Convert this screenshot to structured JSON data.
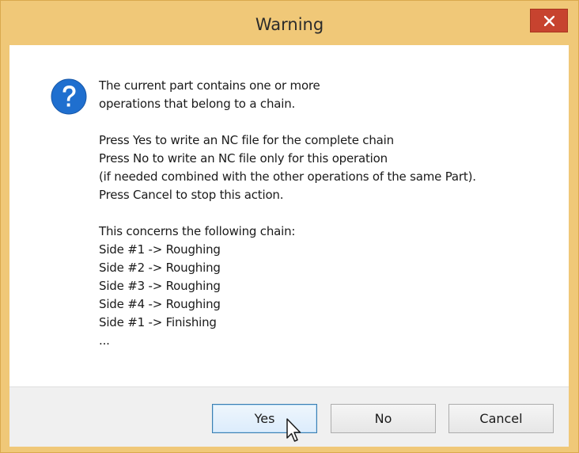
{
  "window": {
    "title": "Warning",
    "close_label": "Close"
  },
  "dialog": {
    "icon": "question-icon",
    "message_lines": [
      "The current part contains one or more",
      "operations that belong to a chain."
    ],
    "instruction_lines": [
      "Press Yes to write an NC file for the complete chain",
      "Press No to write an NC file only for this operation",
      "(if needed combined with the other operations of the same Part).",
      "Press Cancel to stop this action."
    ],
    "chain_header": "This concerns the following chain:",
    "chain_items": [
      "Side #1 -> Roughing",
      "Side #2 -> Roughing",
      "Side #3 -> Roughing",
      "Side #4 -> Roughing",
      "Side #1 -> Finishing"
    ],
    "ellipsis": "..."
  },
  "buttons": {
    "yes": "Yes",
    "no": "No",
    "cancel": "Cancel"
  },
  "colors": {
    "titlebar": "#f0c878",
    "close_button": "#c7432f",
    "icon_blue": "#1f6fcf",
    "default_button_border": "#3c7fb1"
  }
}
